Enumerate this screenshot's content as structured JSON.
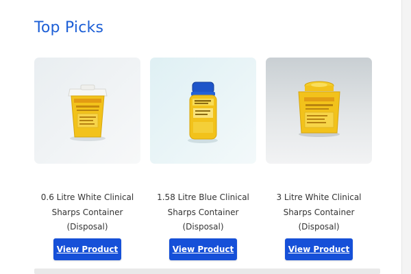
{
  "section": {
    "title": "Top Picks"
  },
  "products": [
    {
      "name_line1": "0.6 Litre White Clinical",
      "name_line2": "Sharps Container",
      "name_line3": "(Disposal)",
      "button_label": "View Product",
      "image": "yellow-container-white-lid"
    },
    {
      "name_line1": "1.58 Litre Blue Clinical",
      "name_line2": "Sharps Container",
      "name_line3": "(Disposal)",
      "button_label": "View Product",
      "image": "yellow-container-blue-lid"
    },
    {
      "name_line1": "3 Litre White Clinical",
      "name_line2": "Sharps Container",
      "name_line3": "(Disposal)",
      "button_label": "View Product",
      "image": "yellow-container-yellow-lid"
    }
  ],
  "colors": {
    "title": "#1d5fd6",
    "button": "#1650d8",
    "container_body": "#f2c21b"
  }
}
